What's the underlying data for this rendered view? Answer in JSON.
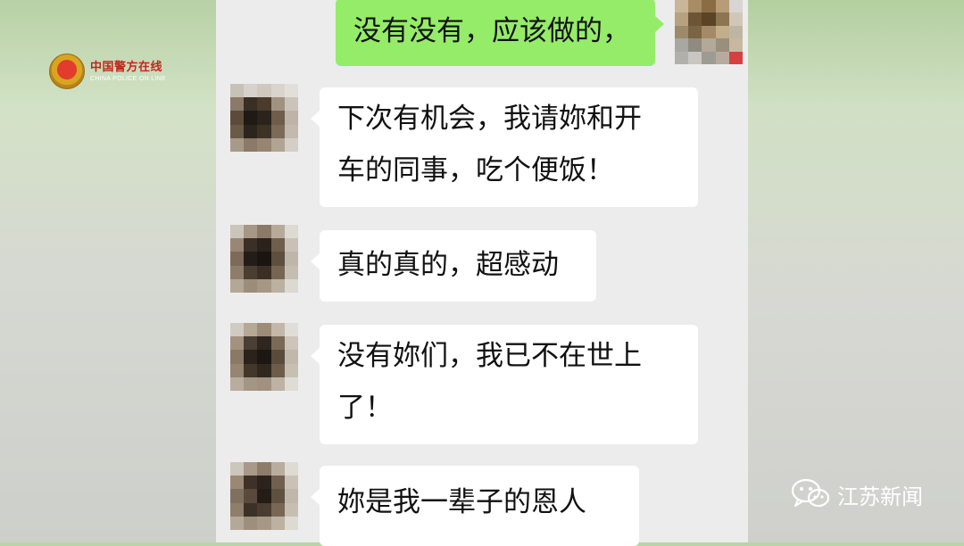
{
  "logo": {
    "name_cn": "中国警方在线",
    "name_en": "CHINA POLICE ON LINE",
    "icon": "police-badge-icon"
  },
  "chat": {
    "outgoing": [
      {
        "text": "没有没有，应该做的，"
      }
    ],
    "incoming": [
      {
        "line1": "下次有机会，我请妳和开",
        "line2": "车的同事，吃个便饭！"
      },
      {
        "line1": "真的真的，超感动"
      },
      {
        "line1": "没有妳们，我已不在世上",
        "line2": "了！"
      },
      {
        "line1": "妳是我一辈子的恩人"
      }
    ]
  },
  "watermark": {
    "icon": "wechat-icon",
    "text": "江苏新闻"
  },
  "colors": {
    "outgoing_bubble": "#95ec69",
    "incoming_bubble": "#ffffff",
    "chat_background": "#ececec",
    "logo_red": "#c0281c"
  }
}
